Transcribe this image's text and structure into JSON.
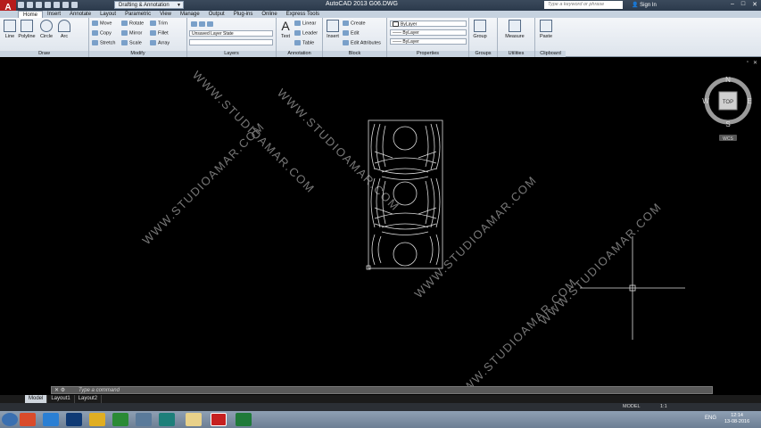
{
  "titlebar": {
    "app_logo": "A",
    "workspace": "Drafting & Annotation",
    "title": "AutoCAD 2013    G06.DWG",
    "search_placeholder": "Type a keyword or phrase",
    "sign_in": "Sign In"
  },
  "tabs": [
    "Home",
    "Insert",
    "Annotate",
    "Layout",
    "Parametric",
    "View",
    "Manage",
    "Output",
    "Plug-ins",
    "Online",
    "Express Tools"
  ],
  "ribbon": {
    "draw": {
      "title": "Draw",
      "line": "Line",
      "polyline": "Polyline",
      "circle": "Circle",
      "arc": "Arc"
    },
    "modify": {
      "title": "Modify",
      "move": "Move",
      "rotate": "Rotate",
      "trim": "Trim",
      "copy": "Copy",
      "mirror": "Mirror",
      "fillet": "Fillet",
      "stretch": "Stretch",
      "scale": "Scale",
      "array": "Array"
    },
    "layers": {
      "title": "Layers",
      "state": "Unsaved Layer State"
    },
    "annotation": {
      "title": "Annotation",
      "text": "Text",
      "linear": "Linear",
      "leader": "Leader",
      "table": "Table"
    },
    "block": {
      "title": "Block",
      "insert": "Insert",
      "create": "Create",
      "edit": "Edit",
      "edit_attributes": "Edit Attributes"
    },
    "properties": {
      "title": "Properties",
      "color": "ByLayer",
      "linetype": "ByLayer",
      "lineweight": "ByLayer"
    },
    "groups": {
      "title": "Groups",
      "group": "Group"
    },
    "utilities": {
      "title": "Utilities",
      "measure": "Measure"
    },
    "clipboard": {
      "title": "Clipboard",
      "paste": "Paste"
    }
  },
  "viewcube": {
    "n": "N",
    "s": "S",
    "e": "E",
    "w": "W",
    "top": "TOP",
    "wcs": "WCS"
  },
  "watermarks": [
    "WWW.STUDIOAMAR.COM",
    "WWW.STUDIOAMAR.COM",
    "WWW.STUDIOAMAR.COM",
    "WWW.STUDIOAMAR.COM",
    "WWW.STUDIOAMAR.COM",
    "WWW.STUDIOAMAR.COM"
  ],
  "command": {
    "placeholder": "Type a command"
  },
  "layout_tabs": [
    "Model",
    "Layout1",
    "Layout2"
  ],
  "status": {
    "model": "MODEL",
    "scale": "1:1"
  },
  "taskbar": {
    "lang": "ENG",
    "time": "12:14",
    "date": "13-08-2016"
  }
}
